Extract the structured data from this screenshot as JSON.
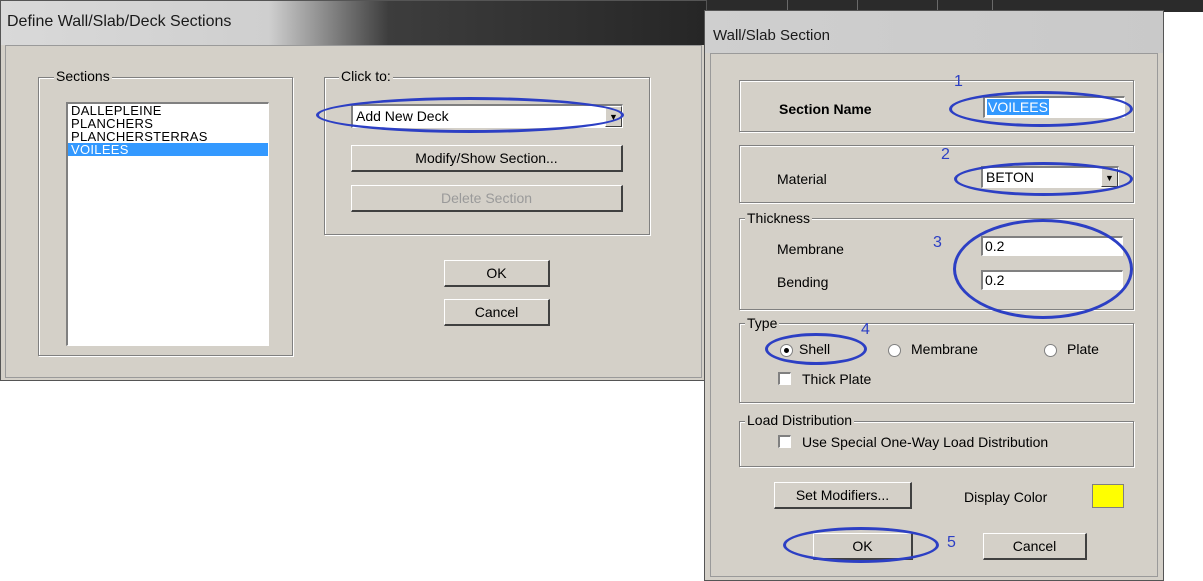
{
  "left_dialog": {
    "title": "Define Wall/Slab/Deck Sections",
    "sections_group_label": "Sections",
    "sections": [
      "DALLEPLEINE",
      "PLANCHERS",
      "PLANCHERSTERRAS",
      "VOILEES"
    ],
    "selected_section": "VOILEES",
    "click_to_group_label": "Click to:",
    "add_combo_value": "Add New Deck",
    "modify_button": "Modify/Show Section...",
    "delete_button": "Delete Section",
    "ok_button": "OK",
    "cancel_button": "Cancel"
  },
  "right_dialog": {
    "title": "Wall/Slab Section",
    "section_name_label": "Section Name",
    "section_name_value": "VOILEES",
    "material_label": "Material",
    "material_value": "BETON",
    "thickness_group_label": "Thickness",
    "membrane_label": "Membrane",
    "membrane_value": "0.2",
    "bending_label": "Bending",
    "bending_value": "0.2",
    "type_group_label": "Type",
    "type_options": [
      "Shell",
      "Membrane",
      "Plate"
    ],
    "type_selected": "Shell",
    "thick_plate_label": "Thick Plate",
    "load_distribution_group_label": "Load Distribution",
    "load_distribution_checkbox_label": "Use Special One-Way Load Distribution",
    "set_modifiers_button": "Set Modifiers...",
    "display_color_label": "Display Color",
    "display_color": "#ffff00",
    "ok_button": "OK",
    "cancel_button": "Cancel"
  },
  "annotations": {
    "step_numbers": [
      "1",
      "2",
      "3",
      "4",
      "5"
    ],
    "color": "#2c3fc4"
  }
}
